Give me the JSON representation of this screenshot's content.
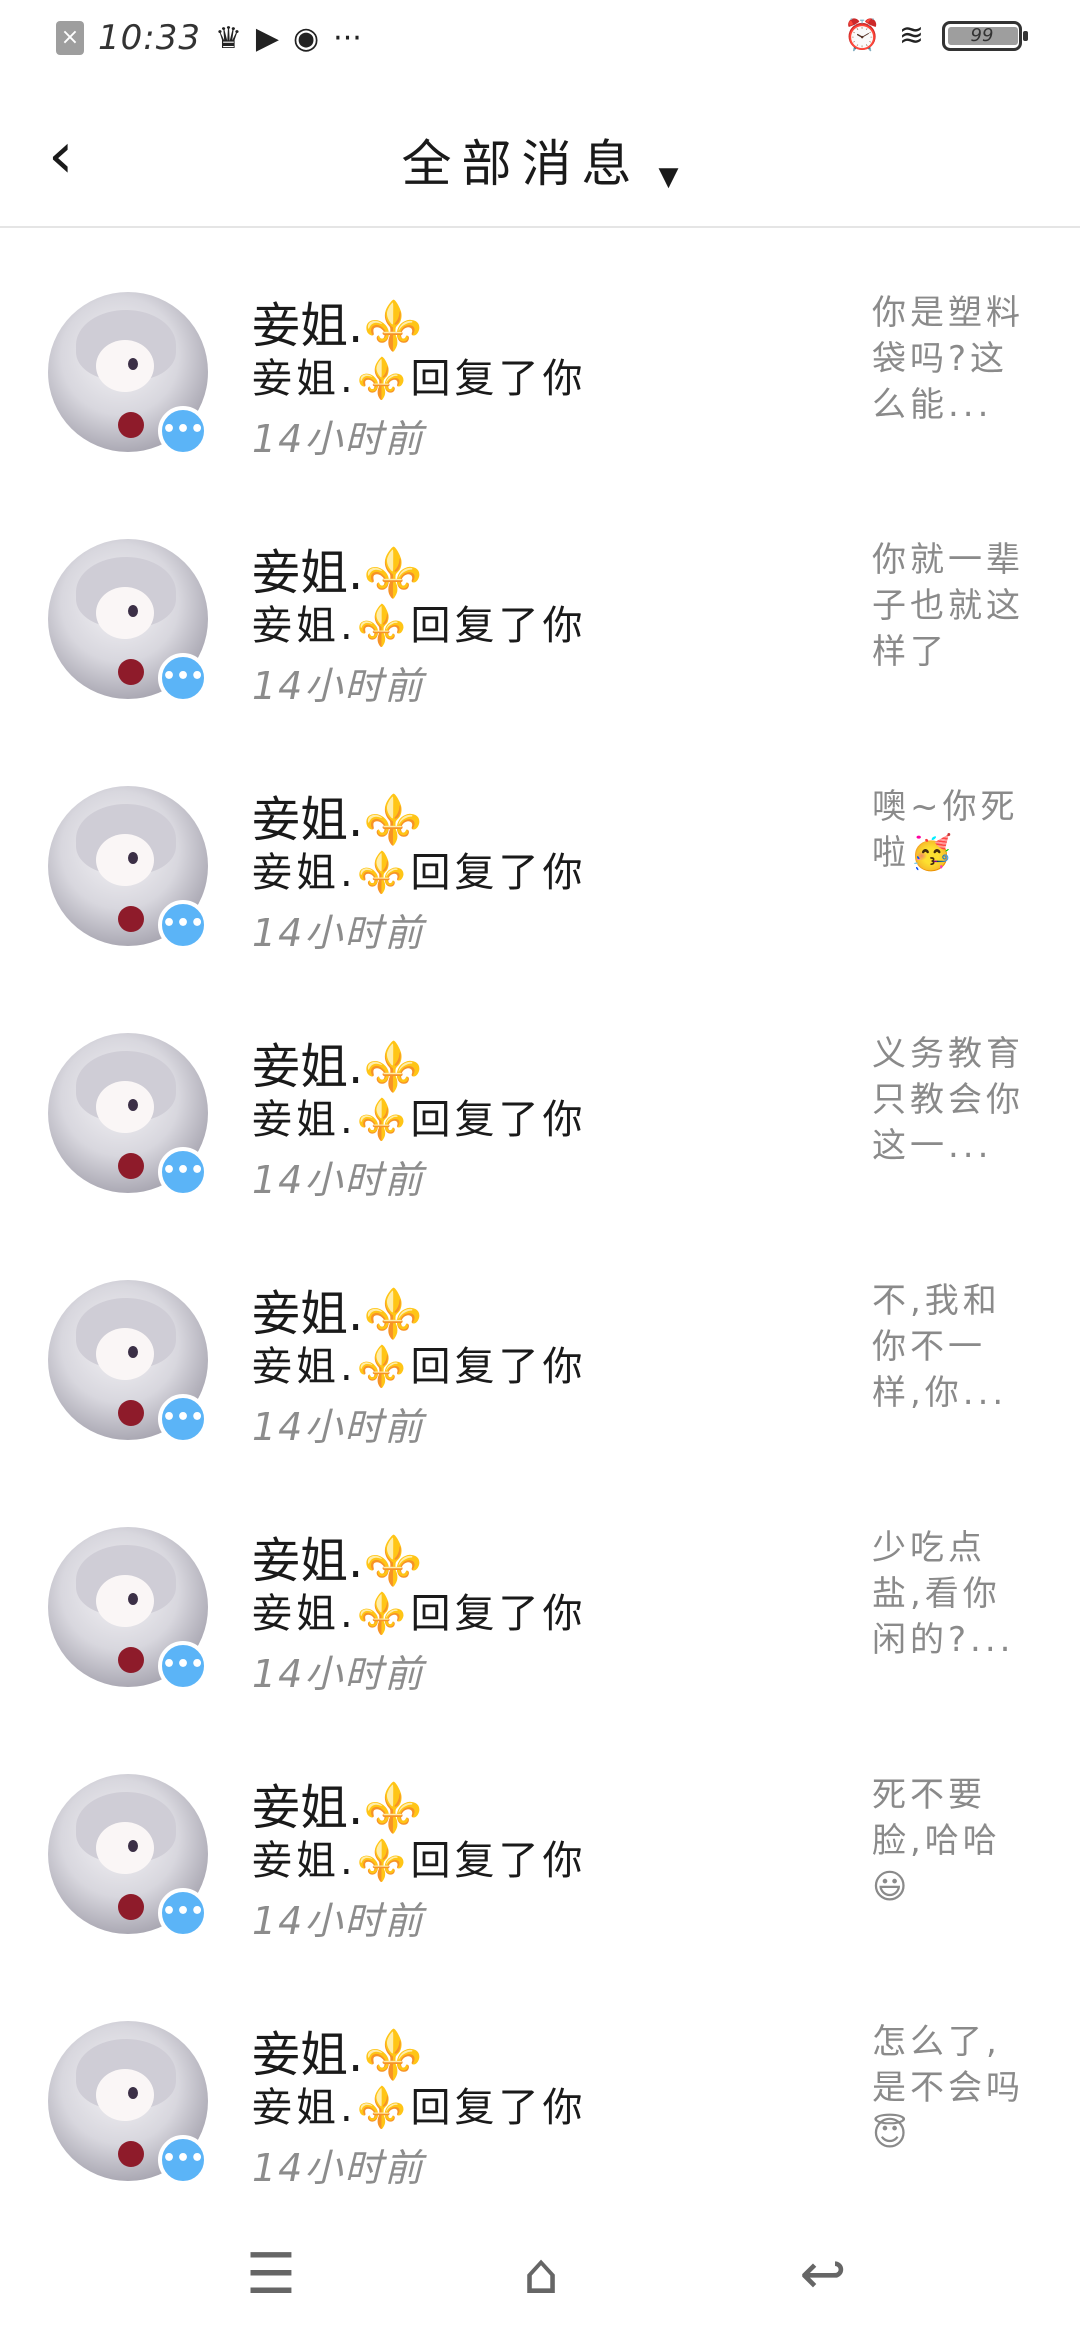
{
  "status_bar": {
    "time": "10:33",
    "battery": "99",
    "left_icons": [
      "close-icon",
      "crown-icon",
      "play-icon",
      "compass-icon",
      "more-icon"
    ],
    "right_icons": [
      "alarm-icon",
      "wifi-icon",
      "battery-icon"
    ]
  },
  "header": {
    "title": "全部消息",
    "back_icon": "back-arrow-icon",
    "dropdown_icon": "caret-down-icon"
  },
  "messages": [
    {
      "name": "妾姐.⚜️",
      "reply": "妾姐.⚜️回复了你",
      "time": "14小时前",
      "preview": "你是塑料袋吗?这么能..."
    },
    {
      "name": "妾姐.⚜️",
      "reply": "妾姐.⚜️回复了你",
      "time": "14小时前",
      "preview": "你就一辈子也就这样了"
    },
    {
      "name": "妾姐.⚜️",
      "reply": "妾姐.⚜️回复了你",
      "time": "14小时前",
      "preview": "噢~你死啦🥳"
    },
    {
      "name": "妾姐.⚜️",
      "reply": "妾姐.⚜️回复了你",
      "time": "14小时前",
      "preview": "义务教育只教会你这一..."
    },
    {
      "name": "妾姐.⚜️",
      "reply": "妾姐.⚜️回复了你",
      "time": "14小时前",
      "preview": "不,我和你不一样,你..."
    },
    {
      "name": "妾姐.⚜️",
      "reply": "妾姐.⚜️回复了你",
      "time": "14小时前",
      "preview": "少吃点盐,看你闲的?..."
    },
    {
      "name": "妾姐.⚜️",
      "reply": "妾姐.⚜️回复了你",
      "time": "14小时前",
      "preview": "死不要脸,哈哈😃"
    },
    {
      "name": "妾姐.⚜️",
      "reply": "妾姐.⚜️回复了你",
      "time": "14小时前",
      "preview": "怎么了,是不会吗😇"
    }
  ],
  "nav_bar": {
    "icons": [
      "menu-icon",
      "home-icon",
      "back-icon"
    ]
  },
  "colors": {
    "badge": "#5bb4f7",
    "fleur": "#f2a51a",
    "time_text": "#8c8c8c",
    "preview_text": "#8a8a8a"
  }
}
